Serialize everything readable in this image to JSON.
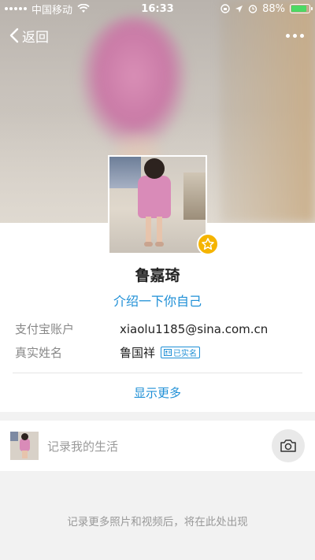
{
  "status_bar": {
    "carrier": "中国移动",
    "time": "16:33",
    "battery_percent": "88%",
    "battery_level": 0.88
  },
  "nav": {
    "back_label": "返回"
  },
  "profile": {
    "name": "鲁嘉琦",
    "intro_link": "介绍一下你自己",
    "rows": [
      {
        "label": "支付宝账户",
        "value": "xiaolu1185@sina.com.cn"
      },
      {
        "label": "真实姓名",
        "value": "鲁国祥",
        "badge": "已实名"
      }
    ],
    "show_more": "显示更多"
  },
  "record": {
    "placeholder": "记录我的生活"
  },
  "empty_tip": "记录更多照片和视频后，将在此处出现",
  "colors": {
    "accent_blue": "#1e8fd6",
    "star_gold": "#f5b400",
    "battery_green": "#4cd964"
  },
  "icons": [
    "signal-icon",
    "wifi-icon",
    "lock-rotation-icon",
    "location-icon",
    "alarm-icon",
    "battery-icon",
    "back-chevron-icon",
    "more-icon",
    "star-icon",
    "verified-id-icon",
    "camera-icon"
  ]
}
